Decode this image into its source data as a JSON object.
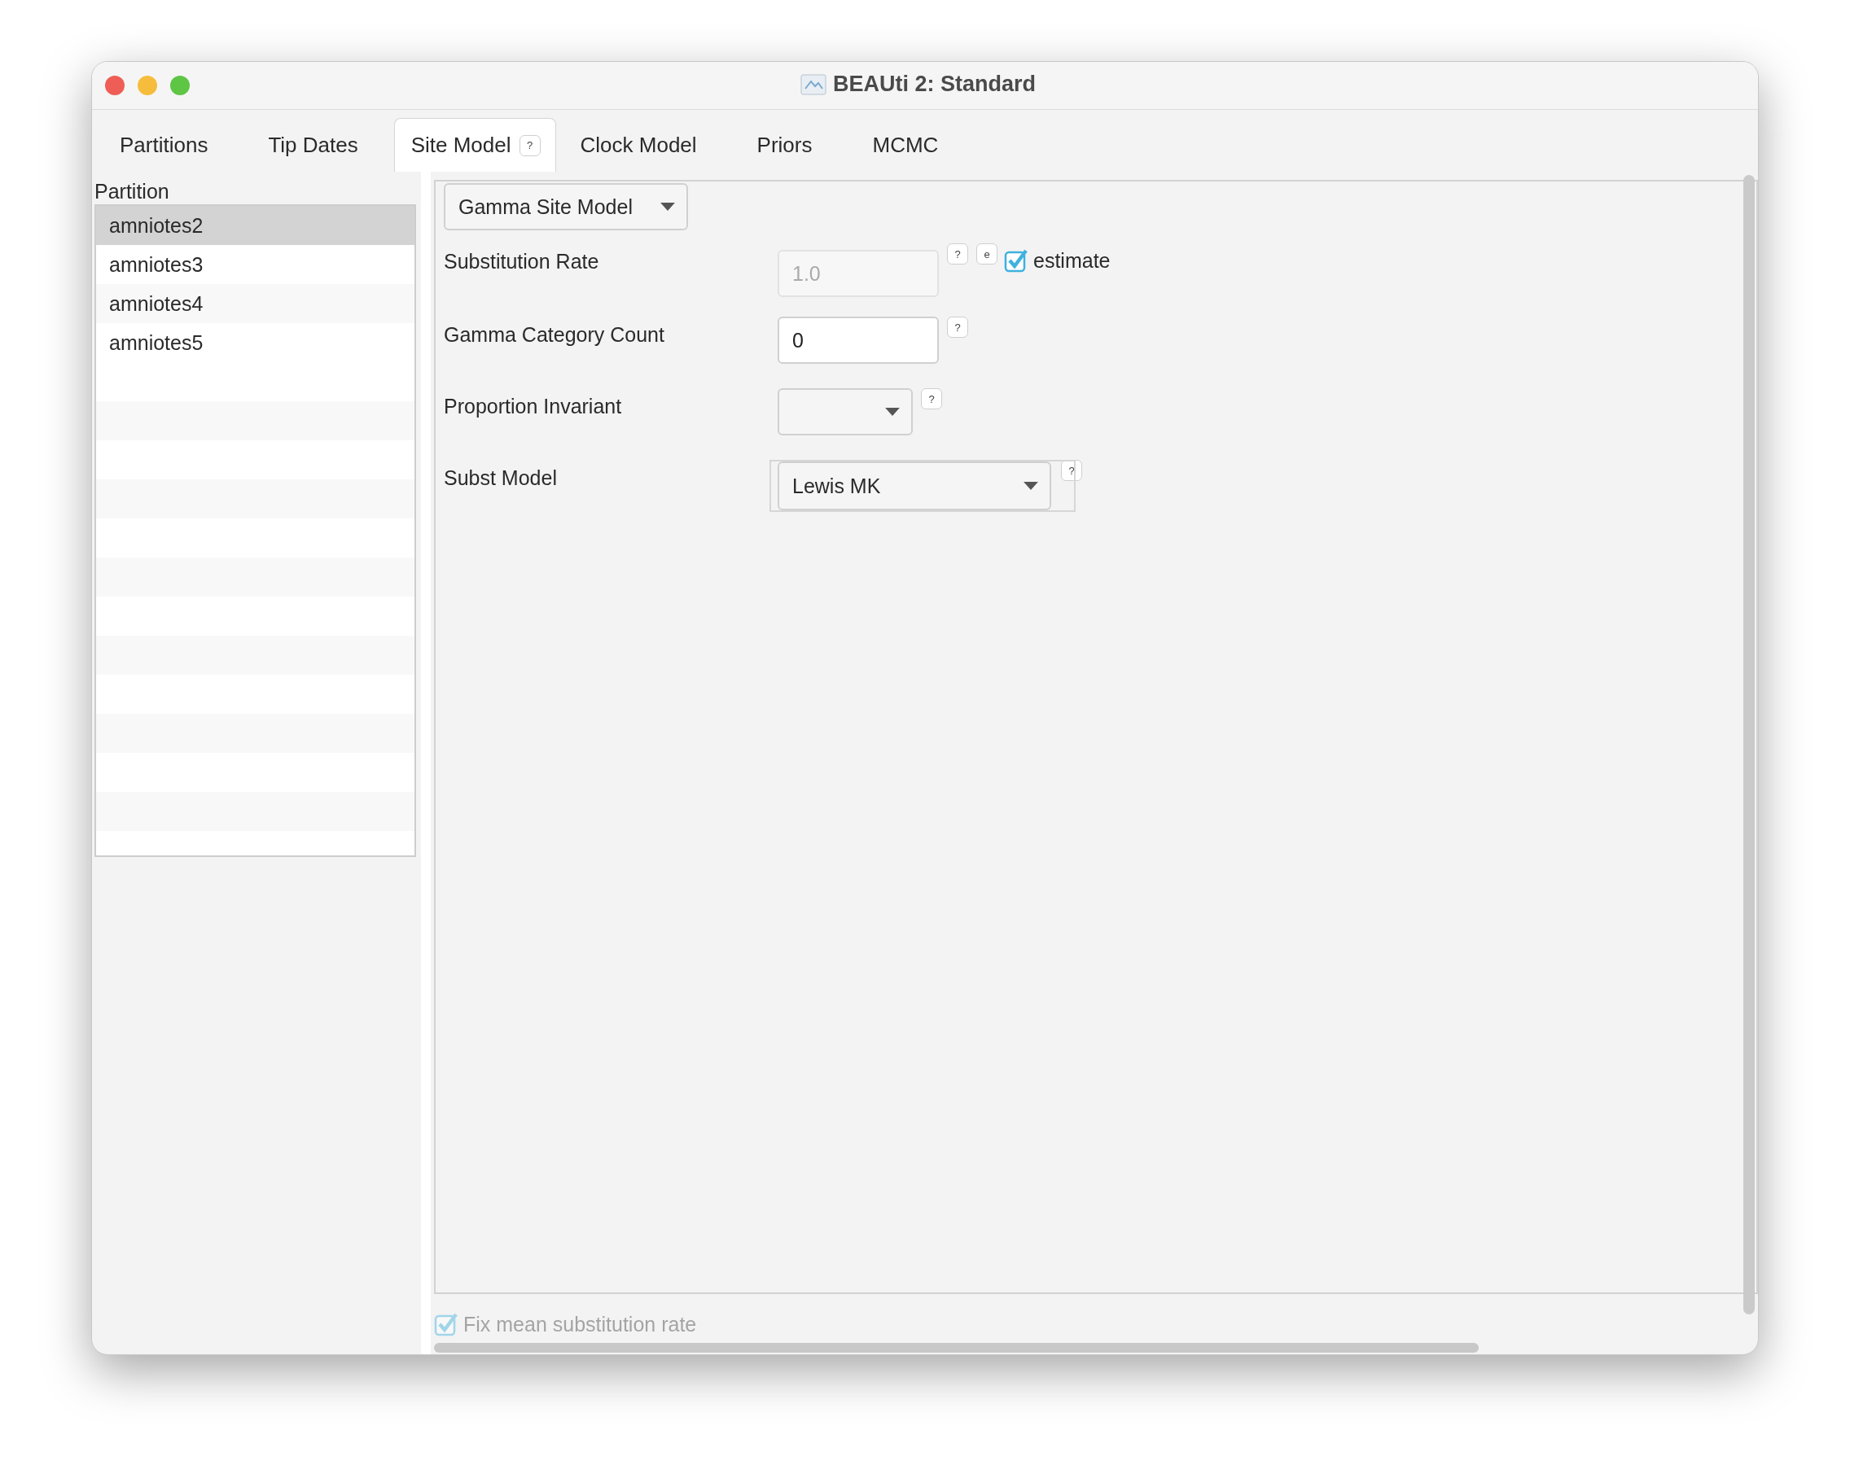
{
  "window": {
    "title": "BEAUti 2: Standard"
  },
  "tabs": [
    {
      "label": "Partitions",
      "selected": false
    },
    {
      "label": "Tip Dates",
      "selected": false
    },
    {
      "label": "Site Model",
      "selected": true,
      "help": "?"
    },
    {
      "label": "Clock Model",
      "selected": false
    },
    {
      "label": "Priors",
      "selected": false
    },
    {
      "label": "MCMC",
      "selected": false
    }
  ],
  "partition_list": {
    "heading": "Partition",
    "items": [
      {
        "label": "amniotes2",
        "selected": true
      },
      {
        "label": "amniotes3",
        "selected": false
      },
      {
        "label": "amniotes4",
        "selected": false
      },
      {
        "label": "amniotes5",
        "selected": false
      }
    ]
  },
  "site_model": {
    "model_select": {
      "value": "Gamma Site Model"
    },
    "fields": [
      {
        "kind": "text",
        "label": "Substitution Rate",
        "value": "1.0",
        "disabled": true,
        "help": "?",
        "estimate_button": "e",
        "estimate": {
          "label": "estimate",
          "checked": true
        }
      },
      {
        "kind": "text",
        "label": "Gamma Category Count",
        "value": "0",
        "disabled": false,
        "help": "?"
      },
      {
        "kind": "select",
        "label": "Proportion Invariant",
        "framed": false,
        "help": "?"
      },
      {
        "kind": "select",
        "label": "Subst Model",
        "value": "Lewis MK",
        "framed": true,
        "help": "?"
      }
    ]
  },
  "fix_mean": {
    "label": "Fix mean substitution rate",
    "checked": true,
    "disabled": true
  }
}
